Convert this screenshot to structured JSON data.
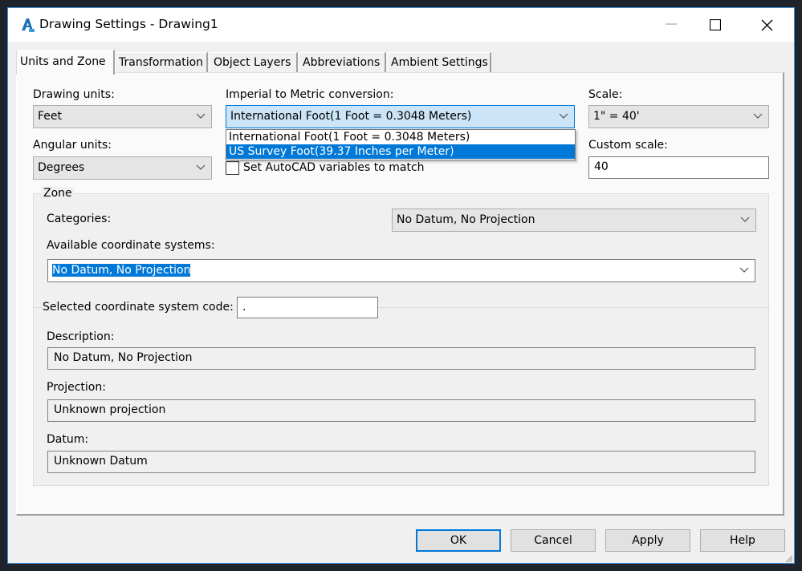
{
  "window": {
    "title": "Drawing Settings - Drawing1",
    "app_icon": "autocad-map-icon",
    "controls": {
      "minimize": "minimize-icon",
      "maximize": "maximize-icon",
      "close": "close-icon"
    }
  },
  "tabs": [
    {
      "label": "Units and Zone",
      "active": true
    },
    {
      "label": "Transformation",
      "active": false
    },
    {
      "label": "Object Layers",
      "active": false
    },
    {
      "label": "Abbreviations",
      "active": false
    },
    {
      "label": "Ambient Settings",
      "active": false
    }
  ],
  "units": {
    "drawing_units_label": "Drawing units:",
    "drawing_units_value": "Feet",
    "angular_units_label": "Angular units:",
    "angular_units_value": "Degrees",
    "conversion_label": "Imperial to Metric conversion:",
    "conversion_value": "International Foot(1 Foot = 0.3048 Meters)",
    "conversion_options": [
      {
        "label": "International Foot(1 Foot = 0.3048 Meters)",
        "highlighted": false
      },
      {
        "label": "US Survey Foot(39.37 Inches per Meter)",
        "highlighted": true
      }
    ],
    "set_variables_label": "Set AutoCAD variables to match",
    "set_variables_checked": false,
    "scale_label": "Scale:",
    "scale_value": "1\" = 40'",
    "custom_scale_label": "Custom scale:",
    "custom_scale_value": "40"
  },
  "zone": {
    "group_title": "Zone",
    "categories_label": "Categories:",
    "categories_value": "No Datum, No Projection",
    "available_label": "Available coordinate systems:",
    "available_value": "No Datum, No Projection",
    "code_label": "Selected coordinate system code:",
    "code_value": ".",
    "description_label": "Description:",
    "description_value": "No Datum, No Projection",
    "projection_label": "Projection:",
    "projection_value": "Unknown projection",
    "datum_label": "Datum:",
    "datum_value": "Unknown Datum"
  },
  "buttons": {
    "ok": "OK",
    "cancel": "Cancel",
    "apply": "Apply",
    "help": "Help"
  },
  "colors": {
    "accent": "#0078d7",
    "window_border": "#3d8fd6",
    "background": "#f0f0f0"
  }
}
